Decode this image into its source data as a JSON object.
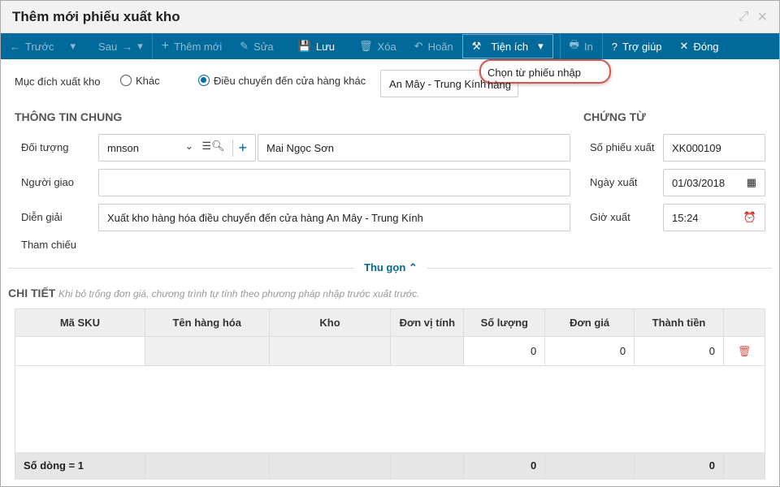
{
  "window": {
    "title": "Thêm mới phiếu xuất kho"
  },
  "toolbar": {
    "prev": "Trước",
    "next": "Sau",
    "add": "Thêm mới",
    "edit": "Sửa",
    "save": "Lưu",
    "delete": "Xóa",
    "undo": "Hoãn",
    "utilities": "Tiện ích",
    "print": "In",
    "help": "Trợ giúp",
    "close": "Đóng"
  },
  "utilities_menu": {
    "items": [
      "Chọn từ phiếu nhập hàng"
    ]
  },
  "purpose": {
    "label": "Mục đích xuất kho",
    "option_other": "Khác",
    "option_transfer": "Điều chuyển đến cửa hàng khác",
    "selected": "transfer",
    "store": "An Mây - Trung Kính"
  },
  "general": {
    "title": "THÔNG TIN CHUNG",
    "object_label": "Đối tượng",
    "object_code": "mnson",
    "object_name": "Mai Ngọc Sơn",
    "deliverer_label": "Người giao",
    "deliverer": "",
    "desc_label": "Diễn giải",
    "desc": "Xuất kho hàng hóa điều chuyển đến cửa hàng An Mây - Trung Kính",
    "ref_label": "Tham chiếu"
  },
  "voucher": {
    "title": "CHỨNG TỪ",
    "no_label": "Số phiếu xuất",
    "no": "XK000109",
    "date_label": "Ngày xuất",
    "date": "01/03/2018",
    "time_label": "Giờ xuất",
    "time": "15:24"
  },
  "collapse": "Thu gọn",
  "detail": {
    "title": "CHI TIẾT",
    "hint": "Khi bỏ trống đơn giá, chương trình tự tính theo phương pháp nhập trước xuất trước.",
    "columns": [
      "Mã SKU",
      "Tên hàng hóa",
      "Kho",
      "Đơn vị tính",
      "Số lượng",
      "Đơn giá",
      "Thành tiền"
    ],
    "rows": [
      {
        "qty": "0",
        "price": "0",
        "amount": "0"
      }
    ],
    "footer": {
      "count": "Số dòng = 1",
      "qty": "0",
      "amount": "0"
    }
  }
}
